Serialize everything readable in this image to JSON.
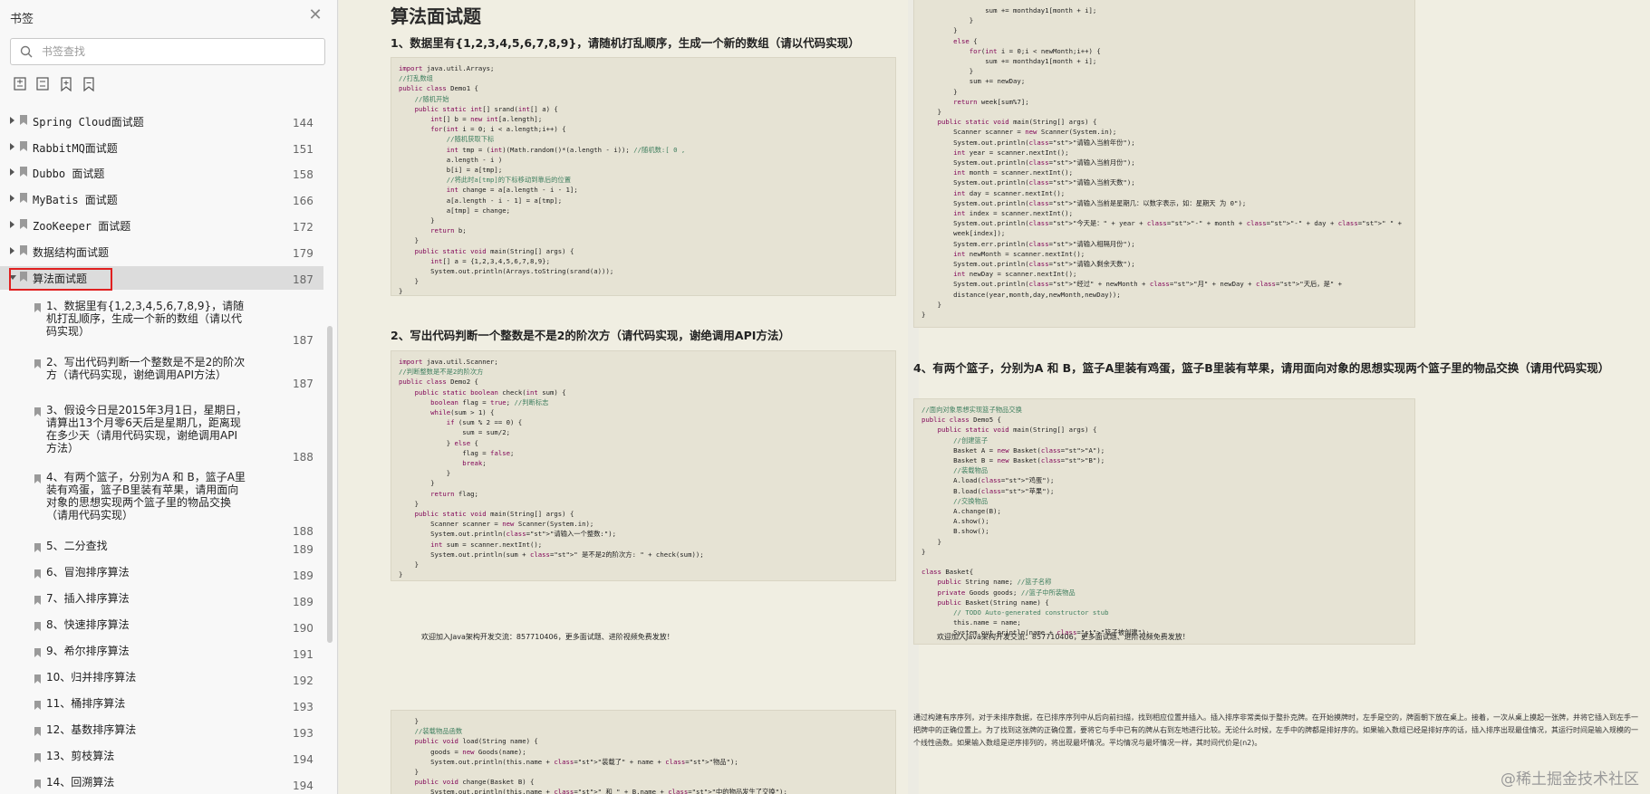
{
  "sidebar": {
    "title": "书签",
    "search_placeholder": "书签查找",
    "top_items": [
      {
        "label": "Spring Cloud面试题",
        "page": "144"
      },
      {
        "label": "RabbitMQ面试题",
        "page": "151"
      },
      {
        "label": "Dubbo 面试题",
        "page": "158"
      },
      {
        "label": "MyBatis 面试题",
        "page": "166"
      },
      {
        "label": "ZooKeeper 面试题",
        "page": "172"
      },
      {
        "label": "数据结构面试题",
        "page": "179"
      },
      {
        "label": "算法面试题",
        "page": "187"
      }
    ],
    "sub_items": [
      {
        "label": "1、数据里有{1,2,3,4,5,6,7,8,9}，请随机打乱顺序，生成一个新的数组（请以代码实现）",
        "page": "187"
      },
      {
        "label": "2、写出代码判断一个整数是不是2的阶次方（请代码实现，谢绝调用API方法）",
        "page": "187"
      },
      {
        "label": "3、假设今日是2015年3月1日，星期日，请算出13个月零6天后是星期几，距离现在多少天（请用代码实现，谢绝调用API方法）",
        "page": "188"
      },
      {
        "label": "4、有两个篮子，分别为A 和 B，篮子A里装有鸡蛋，篮子B里装有苹果，请用面向对象的思想实现两个篮子里的物品交换（请用代码实现）",
        "page": "188"
      },
      {
        "label": "5、二分查找",
        "page": "189"
      },
      {
        "label": "6、冒泡排序算法",
        "page": "189"
      },
      {
        "label": "7、插入排序算法",
        "page": "189"
      },
      {
        "label": "8、快速排序算法",
        "page": "190"
      },
      {
        "label": "9、希尔排序算法",
        "page": "191"
      },
      {
        "label": "10、归并排序算法",
        "page": "192"
      },
      {
        "label": "11、桶排序算法",
        "page": "193"
      },
      {
        "label": "12、基数排序算法",
        "page": "193"
      },
      {
        "label": "13、剪枝算法",
        "page": "194"
      },
      {
        "label": "14、回溯算法",
        "page": "194"
      }
    ]
  },
  "document": {
    "heading": "算法面试题",
    "q1": "1、数据里有{1,2,3,4,5,6,7,8,9}，请随机打乱顺序，生成一个新的数组（请以代码实现）",
    "q2": "2、写出代码判断一个整数是不是2的阶次方（请代码实现，谢绝调用API方法）",
    "q4": "4、有两个篮子，分别为A 和 B，篮子A里装有鸡蛋，篮子B里装有苹果，请用面向对象的思想实现两个篮子里的物品交换（请用代码实现）",
    "footer_note": "欢迎加入Java架构开发交流：857710406，更多面试题、进阶视频免费发放！",
    "code1": [
      "import java.util.Arrays;",
      "//打乱数组",
      "public class Demo1 {",
      "    //随机开始",
      "    public static int[] srand(int[] a) {",
      "        int[] b = new int[a.length];",
      "        for(int i = 0; i < a.length;i++) {",
      "            //随机获取下标",
      "            int tmp = (int)(Math.random()*(a.length - i)); //随机数:[ 0 ,",
      "            a.length - i )",
      "            b[i] = a[tmp];",
      "            //将此时a[tmp]的下标移动到靠后的位置",
      "            int change = a[a.length - i - 1];",
      "            a[a.length - i - 1] = a[tmp];",
      "            a[tmp] = change;",
      "        }",
      "        return b;",
      "    }",
      "    public static void main(String[] args) {",
      "        int[] a = {1,2,3,4,5,6,7,8,9};",
      "        System.out.println(Arrays.toString(srand(a)));",
      "    }",
      "}"
    ],
    "code2": [
      "import java.util.Scanner;",
      "//判断整数是不是2的阶次方",
      "public class Demo2 {",
      "    public static boolean check(int sum) {",
      "        boolean flag = true; //判断标志",
      "        while(sum > 1) {",
      "            if (sum % 2 == 0) {",
      "                sum = sum/2;",
      "            } else {",
      "                flag = false;",
      "                break;",
      "            }",
      "        }",
      "        return flag;",
      "    }",
      "    public static void main(String[] args) {",
      "        Scanner scanner = new Scanner(System.in);",
      "        System.out.println(\"请输入一个整数:\");",
      "        int sum = scanner.nextInt();",
      "        System.out.println(sum + \" 是不是2的阶次方: \" + check(sum));",
      "    }",
      "}"
    ],
    "code3": [
      "                sum += monthday1[month + i];",
      "            }",
      "        }",
      "        else {",
      "            for(int i = 0;i < newMonth;i++) {",
      "                sum += monthday1[month + i];",
      "            }",
      "            sum += newDay;",
      "        }",
      "        return week[sum%7];",
      "    }",
      "    public static void main(String[] args) {",
      "        Scanner scanner = new Scanner(System.in);",
      "        System.out.println(\"请输入当前年份\");",
      "        int year = scanner.nextInt();",
      "        System.out.println(\"请输入当前月份\");",
      "        int month = scanner.nextInt();",
      "        System.out.println(\"请输入当前天数\");",
      "        int day = scanner.nextInt();",
      "        System.out.println(\"请输入当前是星期几：以数字表示，如：星期天 为 0\");",
      "        int index = scanner.nextInt();",
      "        System.out.println(\"今天是：\" + year + \"-\" + month + \"-\" + day + \" \" +",
      "        week[index]);",
      "        System.err.println(\"请输入相隔月份\");",
      "        int newMonth = scanner.nextInt();",
      "        System.out.println(\"请输入剩余天数\");",
      "        int newDay = scanner.nextInt();",
      "        System.out.println(\"经过\" + newMonth + \"月\" + newDay + \"天后，是\" +",
      "        distance(year,month,day,newMonth,newDay));",
      "    }",
      "}"
    ],
    "code4": [
      "//面向对象思想实现篮子物品交换",
      "public class Demo5 {",
      "    public static void main(String[] args) {",
      "        //创建篮子",
      "        Basket A = new Basket(\"A\");",
      "        Basket B = new Basket(\"B\");",
      "        //装载物品",
      "        A.load(\"鸡蛋\");",
      "        B.load(\"苹果\");",
      "        //交换物品",
      "        A.change(B);",
      "        A.show();",
      "        B.show();",
      "    }",
      "}",
      "",
      "class Basket{",
      "    public String name; //篮子名称",
      "    private Goods goods; //篮子中所装物品",
      "    public Basket(String name) {",
      "        // TODO Auto-generated constructor stub",
      "        this.name = name;",
      "        System.out.println(name + \"篮子被创建\");"
    ],
    "code5": [
      "    }",
      "    //装载物品函数",
      "    public void load(String name) {",
      "        goods = new Goods(name);",
      "        System.out.println(this.name + \"装载了\" + name + \"物品\");",
      "    }",
      "    public void change(Basket B) {",
      "        System.out.println(this.name + \" 和 \" + B.name + \"中的物品发生了交换\");"
    ],
    "paragraph": "通过构建有序序列，对于未排序数据，在已排序序列中从后向前扫描，找到相应位置并插入。插入排序非常类似于整扑克牌。在开始摸牌时，左手是空的，牌面朝下放在桌上。接着，一次从桌上摸起一张牌，并将它插入到左手一把牌中的正确位置上。为了找到这张牌的正确位置，要将它与手中已有的牌从右到左地进行比较。无论什么时候，左手中的牌都是排好序的。如果输入数组已经是排好序的话，插入排序出现最佳情况，其运行时间是输入规模的一个线性函数。如果输入数组是逆序排列的，将出现最坏情况。平均情况与最坏情况一样，其时间代价是(n2)。",
    "watermark": "@稀土掘金技术社区"
  }
}
